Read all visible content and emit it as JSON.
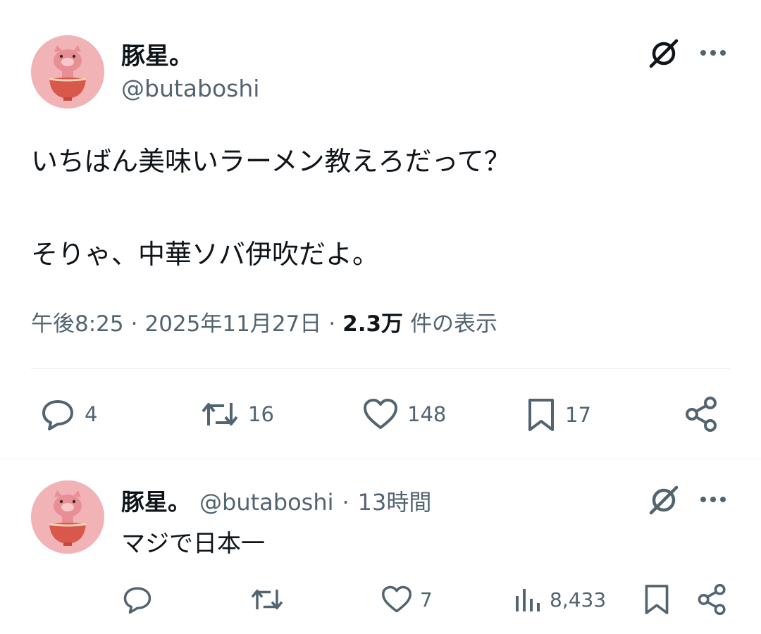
{
  "post": {
    "author_name": "豚星。",
    "author_handle": "@butaboshi",
    "text_line1": "いちばん美味いラーメン教えろだって？",
    "text_line2": "そりゃ、中華ソバ伊吹だよ。",
    "time": "午後8:25",
    "sep1": "·",
    "date": "2025年11月27日",
    "sep2": "·",
    "views_count": "2.3万",
    "views_label": "件の表示",
    "replies": "4",
    "reposts": "16",
    "likes": "148",
    "bookmarks": "17"
  },
  "reply": {
    "author_name": "豚星。",
    "author_handle": "@butaboshi",
    "sep": "·",
    "time_ago": "13時間",
    "text": "マジで日本一",
    "likes": "7",
    "views": "8,433"
  },
  "icons": {
    "grok": "grok-slash-circle-icon",
    "more": "more-dots-icon",
    "reply": "reply-bubble-icon",
    "repost": "repost-arrows-icon",
    "like": "heart-icon",
    "bookmark": "bookmark-icon",
    "share": "share-icon",
    "views": "views-bars-icon"
  },
  "colors": {
    "text": "#0f1419",
    "muted": "#536471",
    "avatar_bg": "#f2b3b7",
    "bowl": "#d8584b"
  }
}
